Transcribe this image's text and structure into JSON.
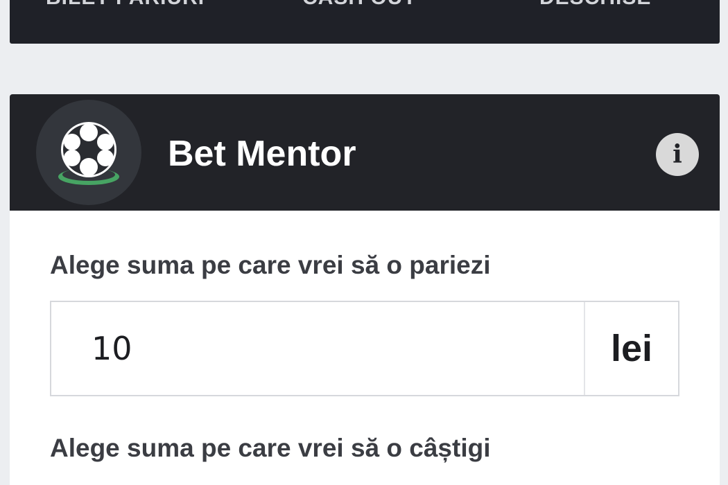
{
  "nav": {
    "tabs": [
      {
        "label": "BILET PARIURI"
      },
      {
        "label": "CASH OUT"
      },
      {
        "label": "DESCHISE"
      }
    ]
  },
  "panel": {
    "title": "Bet Mentor",
    "logo_icon": "soccer-ball-icon",
    "info_icon": "info-icon",
    "info_glyph": "i"
  },
  "form": {
    "stake_label": "Alege suma pe care vrei să o pariezi",
    "stake_value": "10",
    "currency": "lei",
    "win_label": "Alege suma pe care vrei să o câștigi"
  },
  "colors": {
    "background": "#eceef1",
    "header_dark": "#222328",
    "accent_green": "#47a463"
  }
}
